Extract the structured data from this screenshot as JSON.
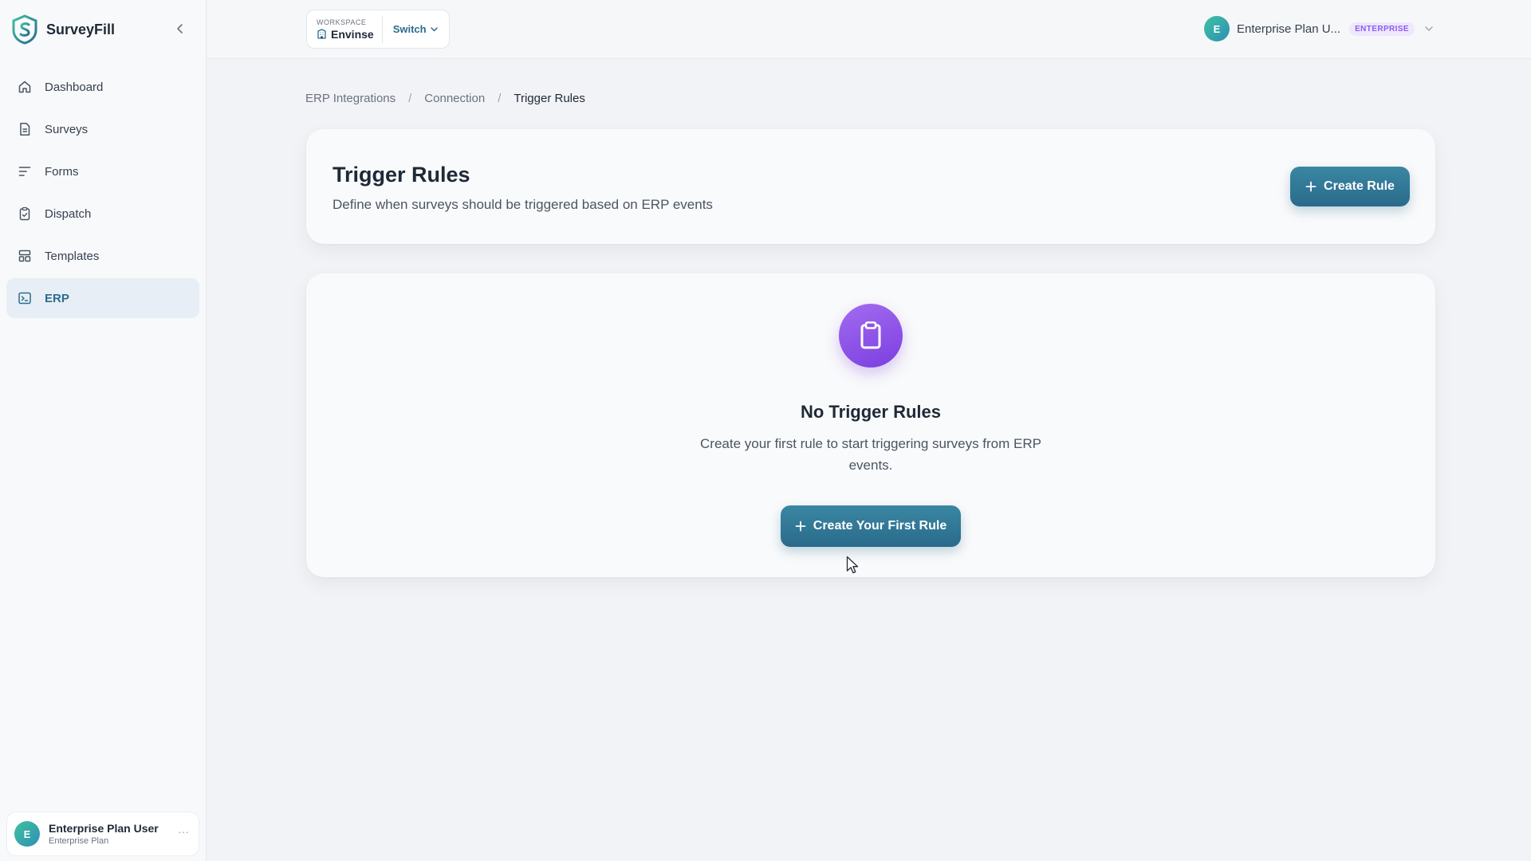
{
  "app": {
    "name": "SurveyFill"
  },
  "sidebar": {
    "items": [
      {
        "label": "Dashboard",
        "icon": "home-icon"
      },
      {
        "label": "Surveys",
        "icon": "document-icon"
      },
      {
        "label": "Forms",
        "icon": "lines-icon"
      },
      {
        "label": "Dispatch",
        "icon": "clipboard-check-icon"
      },
      {
        "label": "Templates",
        "icon": "layout-icon"
      },
      {
        "label": "ERP",
        "icon": "terminal-icon",
        "active": true
      }
    ],
    "user": {
      "initial": "E",
      "name": "Enterprise Plan User",
      "plan": "Enterprise Plan",
      "menu": "···"
    }
  },
  "topbar": {
    "workspace": {
      "label": "WORKSPACE",
      "name": "Envinse",
      "switch_label": "Switch"
    },
    "account": {
      "initial": "E",
      "name": "Enterprise Plan U...",
      "badge": "ENTERPRISE"
    }
  },
  "breadcrumb": [
    {
      "label": "ERP Integrations"
    },
    {
      "label": "Connection"
    },
    {
      "label": "Trigger Rules"
    }
  ],
  "breadcrumb_separator": "/",
  "header": {
    "title": "Trigger Rules",
    "subtitle": "Define when surveys should be triggered based on ERP events",
    "create_button": "Create Rule"
  },
  "empty_state": {
    "icon": "clipboard-icon",
    "title": "No Trigger Rules",
    "description": "Create your first rule to start triggering surveys from ERP events.",
    "button": "Create Your First Rule"
  },
  "colors": {
    "primary": "#2a6a8b",
    "accent_purple": "#8b5cf6",
    "avatar_teal": "#3fc1a0"
  }
}
